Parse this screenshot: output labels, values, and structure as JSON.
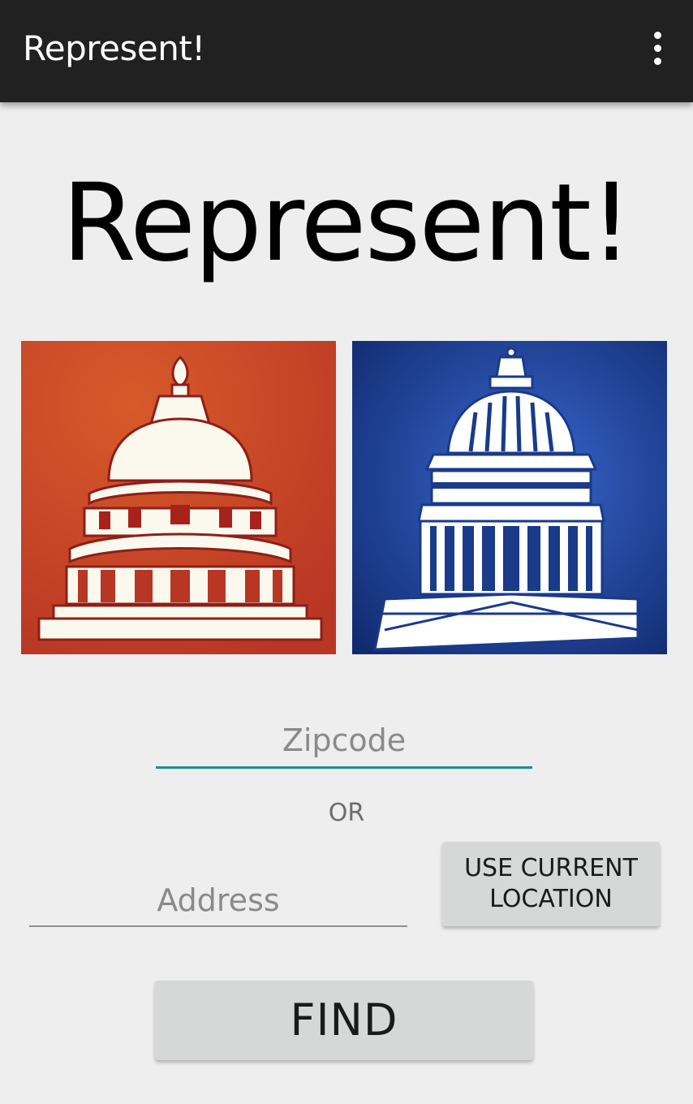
{
  "app_bar": {
    "title": "Represent!",
    "menu_icon": "more-vert-icon"
  },
  "main": {
    "heading": "Represent!",
    "logos": [
      {
        "name": "capitol-red-logo",
        "color": "#c8492a"
      },
      {
        "name": "capitol-blue-logo",
        "color": "#1a3a8a"
      }
    ],
    "zipcode": {
      "value": "",
      "placeholder": "Zipcode"
    },
    "or_label": "OR",
    "address": {
      "value": "",
      "placeholder": "Address"
    },
    "location_button_label": "USE CURRENT\nLOCATION",
    "find_button_label": "FIND"
  },
  "colors": {
    "app_bar": "#212121",
    "background": "#eeeeee",
    "accent": "#15948a",
    "button": "#d6d7d7"
  }
}
